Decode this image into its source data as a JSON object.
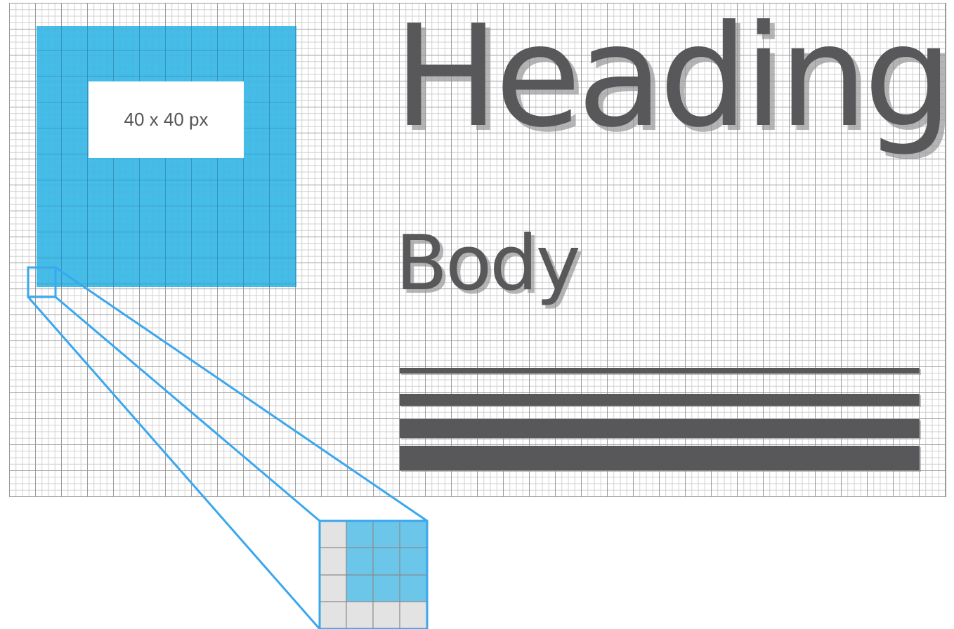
{
  "size_label": "40 x 40 px",
  "heading": "Heading",
  "body": "Body",
  "line_weights": [
    "thin",
    "medium",
    "thick",
    "extra-thick"
  ],
  "colors": {
    "accent_blue": "#36b9e8",
    "zoom_blue": "#6cc6ea",
    "text_dark_gray": "#58585a",
    "grid_major": "#9a9a9a",
    "grid_minor": "#d0d0d0",
    "zoom_outline": "#3aa7ef"
  }
}
